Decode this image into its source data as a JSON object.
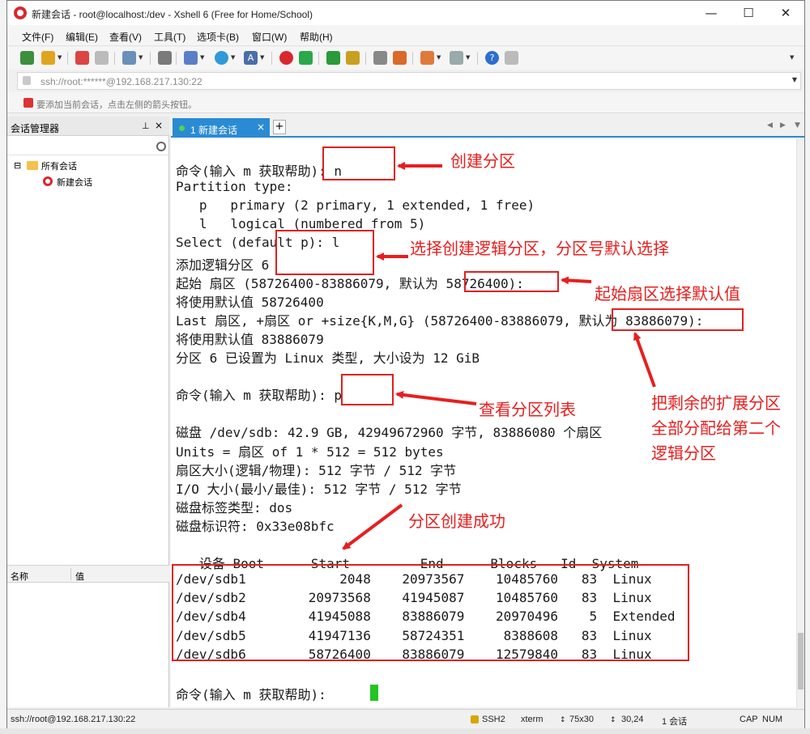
{
  "window": {
    "title": "新建会话 - root@localhost:/dev - Xshell 6 (Free for Home/School)",
    "min": "—",
    "max": "☐",
    "close": "✕"
  },
  "menu": [
    "文件(F)",
    "编辑(E)",
    "查看(V)",
    "工具(T)",
    "选项卡(B)",
    "窗口(W)",
    "帮助(H)"
  ],
  "address": {
    "value": "ssh://root:******@192.168.217.130:22"
  },
  "hint": "要添加当前会话，点击左侧的箭头按钮。",
  "session_manager": {
    "title": "会话管理器",
    "tree": {
      "root": "所有会话",
      "child": "新建会话",
      "toggle": "⊟"
    },
    "props_header": {
      "name": "名称",
      "value": "值"
    }
  },
  "tab": {
    "label": "1 新建会话",
    "close": "×",
    "add": "+"
  },
  "terminal": {
    "lines": [
      "命令(输入 m 获取帮助): n",
      "Partition type:",
      "   p   primary (2 primary, 1 extended, 1 free)",
      "   l   logical (numbered from 5)",
      "Select (default p): l",
      "添加逻辑分区 6",
      "起始 扇区 (58726400-83886079, 默认为 58726400):",
      "将使用默认值 58726400",
      "Last 扇区, +扇区 or +size{K,M,G} (58726400-83886079, 默认为 83886079):",
      "将使用默认值 83886079",
      "分区 6 已设置为 Linux 类型, 大小设为 12 GiB",
      "",
      "命令(输入 m 获取帮助): p",
      "",
      "磁盘 /dev/sdb: 42.9 GB, 42949672960 字节, 83886080 个扇区",
      "Units = 扇区 of 1 * 512 = 512 bytes",
      "扇区大小(逻辑/物理): 512 字节 / 512 字节",
      "I/O 大小(最小/最佳): 512 字节 / 512 字节",
      "磁盘标签类型: dos",
      "磁盘标识符: 0x33e08bfc",
      "",
      "   设备 Boot      Start         End      Blocks   Id  System",
      "/dev/sdb1            2048    20973567    10485760   83  Linux",
      "/dev/sdb2        20973568    41945087    10485760   83  Linux",
      "/dev/sdb4        41945088    83886079    20970496    5  Extended",
      "/dev/sdb5        41947136    58724351     8388608   83  Linux",
      "/dev/sdb6        58726400    83886079    12579840   83  Linux",
      "",
      "命令(输入 m 获取帮助): "
    ]
  },
  "annotations": {
    "create_partition": "创建分区",
    "select_logical": "选择创建逻辑分区，分区号默认选择",
    "start_sector": "起始扇区选择默认值",
    "view_list": "查看分区列表",
    "remaining_line1": "把剩余的扩展分区",
    "remaining_line2": "全部分配给第二个",
    "remaining_line3": "逻辑分区",
    "success": "分区创建成功",
    "color": "#e81e1e"
  },
  "status": {
    "connection": "ssh://root@192.168.217.130:22",
    "protocol": "SSH2",
    "term": "xterm",
    "size": "75x30",
    "pos": "30,24",
    "sessions": "1 会话",
    "caps": "CAP",
    "num": "NUM"
  }
}
